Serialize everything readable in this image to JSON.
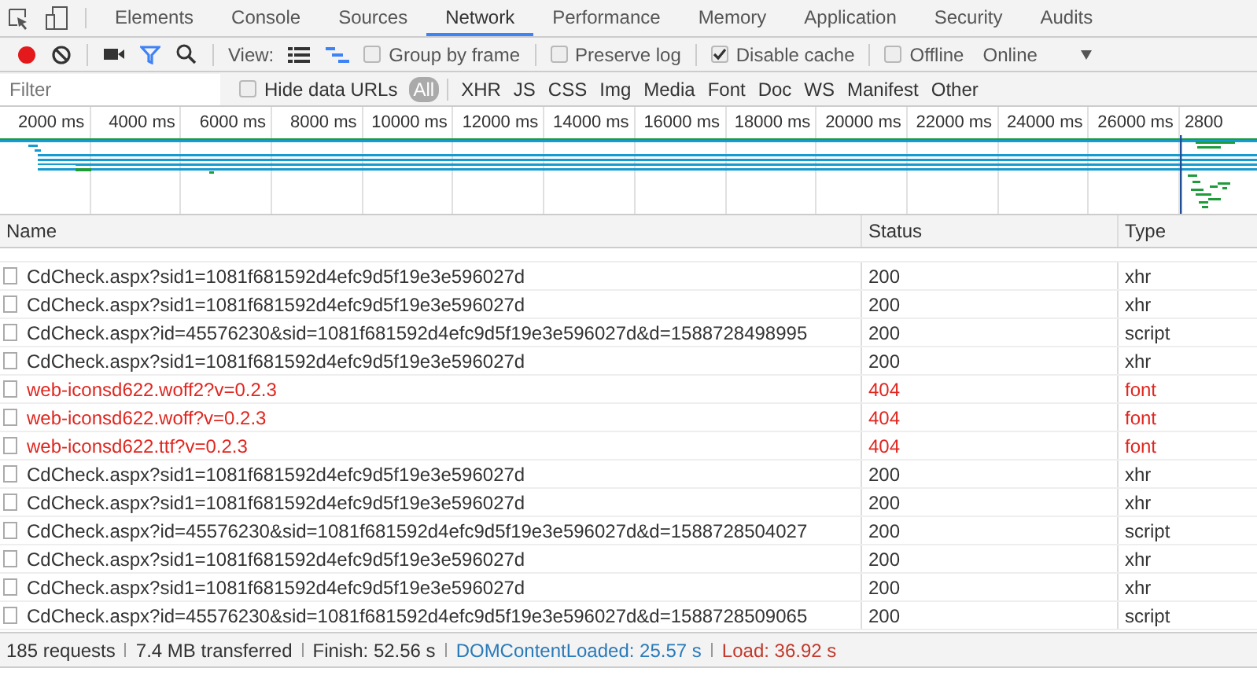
{
  "main_tabs": [
    {
      "label": "Elements",
      "selected": false
    },
    {
      "label": "Console",
      "selected": false
    },
    {
      "label": "Sources",
      "selected": false
    },
    {
      "label": "Network",
      "selected": true
    },
    {
      "label": "Performance",
      "selected": false
    },
    {
      "label": "Memory",
      "selected": false
    },
    {
      "label": "Application",
      "selected": false
    },
    {
      "label": "Security",
      "selected": false
    },
    {
      "label": "Audits",
      "selected": false
    }
  ],
  "toolbar": {
    "recording": true,
    "view_label": "View:",
    "options": [
      {
        "label": "Group by frame",
        "checked": false
      },
      {
        "label": "Preserve log",
        "checked": false
      },
      {
        "label": "Disable cache",
        "checked": true
      },
      {
        "label": "Offline",
        "checked": false
      }
    ],
    "throttling": "Online"
  },
  "filter_bar": {
    "placeholder": "Filter",
    "hide_data_urls": {
      "label": "Hide data URLs",
      "checked": false
    },
    "types": [
      {
        "label": "All",
        "selected": true
      },
      {
        "label": "XHR",
        "selected": false
      },
      {
        "label": "JS",
        "selected": false
      },
      {
        "label": "CSS",
        "selected": false
      },
      {
        "label": "Img",
        "selected": false
      },
      {
        "label": "Media",
        "selected": false
      },
      {
        "label": "Font",
        "selected": false
      },
      {
        "label": "Doc",
        "selected": false
      },
      {
        "label": "WS",
        "selected": false
      },
      {
        "label": "Manifest",
        "selected": false
      },
      {
        "label": "Other",
        "selected": false
      }
    ]
  },
  "overview": {
    "ticks": [
      "2000 ms",
      "4000 ms",
      "6000 ms",
      "8000 ms",
      "10000 ms",
      "12000 ms",
      "14000 ms",
      "16000 ms",
      "18000 ms",
      "20000 ms",
      "22000 ms",
      "24000 ms",
      "26000 ms",
      "2800"
    ]
  },
  "table": {
    "columns": [
      "Name",
      "Status",
      "Type"
    ],
    "rows": [
      {
        "name": "CdCheck.aspx?sid1=1081f681592d4efc9d5f19e3e596027d",
        "status": "200",
        "type": "xhr",
        "failed": false
      },
      {
        "name": "CdCheck.aspx?sid1=1081f681592d4efc9d5f19e3e596027d",
        "status": "200",
        "type": "xhr",
        "failed": false
      },
      {
        "name": "CdCheck.aspx?id=45576230&sid=1081f681592d4efc9d5f19e3e596027d&d=1588728498995",
        "status": "200",
        "type": "script",
        "failed": false
      },
      {
        "name": "CdCheck.aspx?sid1=1081f681592d4efc9d5f19e3e596027d",
        "status": "200",
        "type": "xhr",
        "failed": false
      },
      {
        "name": "web-iconsd622.woff2?v=0.2.3",
        "status": "404",
        "type": "font",
        "failed": true
      },
      {
        "name": "web-iconsd622.woff?v=0.2.3",
        "status": "404",
        "type": "font",
        "failed": true
      },
      {
        "name": "web-iconsd622.ttf?v=0.2.3",
        "status": "404",
        "type": "font",
        "failed": true
      },
      {
        "name": "CdCheck.aspx?sid1=1081f681592d4efc9d5f19e3e596027d",
        "status": "200",
        "type": "xhr",
        "failed": false
      },
      {
        "name": "CdCheck.aspx?sid1=1081f681592d4efc9d5f19e3e596027d",
        "status": "200",
        "type": "xhr",
        "failed": false
      },
      {
        "name": "CdCheck.aspx?id=45576230&sid=1081f681592d4efc9d5f19e3e596027d&d=1588728504027",
        "status": "200",
        "type": "script",
        "failed": false
      },
      {
        "name": "CdCheck.aspx?sid1=1081f681592d4efc9d5f19e3e596027d",
        "status": "200",
        "type": "xhr",
        "failed": false
      },
      {
        "name": "CdCheck.aspx?sid1=1081f681592d4efc9d5f19e3e596027d",
        "status": "200",
        "type": "xhr",
        "failed": false
      },
      {
        "name": "CdCheck.aspx?id=45576230&sid=1081f681592d4efc9d5f19e3e596027d&d=1588728509065",
        "status": "200",
        "type": "script",
        "failed": false
      }
    ]
  },
  "status_bar": [
    {
      "kind": "plain",
      "text": "185 requests"
    },
    {
      "kind": "plain",
      "text": "7.4 MB transferred"
    },
    {
      "kind": "plain",
      "text": "Finish: 52.56 s"
    },
    {
      "kind": "dom",
      "text": "DOMContentLoaded: 25.57 s"
    },
    {
      "kind": "load",
      "text": "Load: 36.92 s"
    }
  ]
}
